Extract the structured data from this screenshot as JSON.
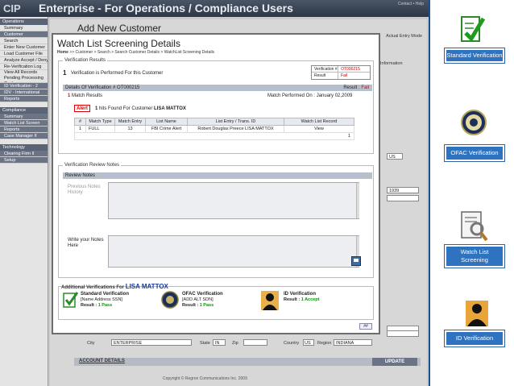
{
  "app": {
    "logo": "CIP",
    "title": "Enterprise - For Operations / Compliance Users",
    "top_links": "Contact • Help"
  },
  "sidebar": {
    "operations_head": "Operations",
    "operations": [
      "Summary",
      "Customer",
      "Search",
      "Enter New Customer",
      "Load Customer File",
      "Analyze Accept / Deny",
      "Re-Verification Log",
      "View All Records Pending Processing Cycle",
      "ID Verification - 2",
      "IDV - International",
      "Reports"
    ],
    "compliance_head": "Compliance",
    "compliance": [
      "Summary",
      "Watch List Screen",
      "Reports",
      "Case Manager II"
    ],
    "technology_head": "Technology",
    "technology": [
      "Clearing Firm II",
      "Setup"
    ]
  },
  "background": {
    "heading": "Add New Customer",
    "view_label": "Actual Entry Mode",
    "fields": {
      "info": "Information",
      "us": "US",
      "num": "1939",
      "city_label": "City",
      "city_value": "ENTERPRISE",
      "state_label": "State",
      "state_value": "IN",
      "zip_label": "Zip",
      "zip_value": "",
      "country_label": "Country",
      "country_value": "US",
      "region_label": "Region",
      "region_value": "INDIANA"
    },
    "account_details": "ACCOUNT DETAILS",
    "update": "UPDATE",
    "copyright": "Copyright © Regron Communications Inc. 2009"
  },
  "modal": {
    "title": "Watch List Screening Details",
    "breadcrumb_home": "Home",
    "breadcrumb_rest": " >> Customer > Search > Search Customer Details > WatchList Screening Details",
    "verification_results_title": "Verification Results",
    "count_num": "1",
    "count_text": "Verification is Performed For this Customer",
    "mini": {
      "k1": "Verification #",
      "v1": "OT000215",
      "k2": "Result",
      "v2": "Fail"
    },
    "details_label": "Details Of Verification # OT000215",
    "result_label": "Result : ",
    "result_value": "Fail",
    "match_results_num": "1",
    "match_results_text": "Match Results",
    "performed_on": "Match Performed On : January 02,2009",
    "alert_label": "Alert",
    "hits_num": "1",
    "hits_text": "hits Found For Customer",
    "hits_name": "LISA MATTOX",
    "table": {
      "headers": [
        "#",
        "Match Type",
        "Match Entry",
        "List Name",
        "List Entry / Trans. ID",
        "Watch List Record"
      ],
      "rows": [
        [
          "1",
          "FULL",
          "13",
          "FBI Crime Alert",
          "Robert Douglas Preece LISA MATTOX",
          "View"
        ]
      ],
      "page": "1"
    },
    "review_notes_title": "Verification Review Notes",
    "review_bar": "Review Notes",
    "previous_notes_label": "Previous Notes History",
    "write_notes_label": "Write your Notes Here",
    "additional_title": "Additional Verifications For",
    "additional_name": "LISA MATTOX",
    "additional": [
      {
        "title": "Standard Verification",
        "sub": "[Name Address SSN]",
        "result_label": "Result : ",
        "result_value": "1 Pass"
      },
      {
        "title": "OFAC Verification",
        "sub": "[ADD ALT SDN]",
        "result_label": "Result : ",
        "result_value": "1 Pass"
      },
      {
        "title": "ID Verification",
        "sub": "",
        "result_label": "Result : ",
        "result_value": "1 Accept"
      }
    ],
    "next": "##"
  },
  "right_panel": {
    "standard": "Standard Verification",
    "ofac": "OFAC Verification",
    "watch": "Watch List Screening",
    "id": "ID Verification"
  }
}
